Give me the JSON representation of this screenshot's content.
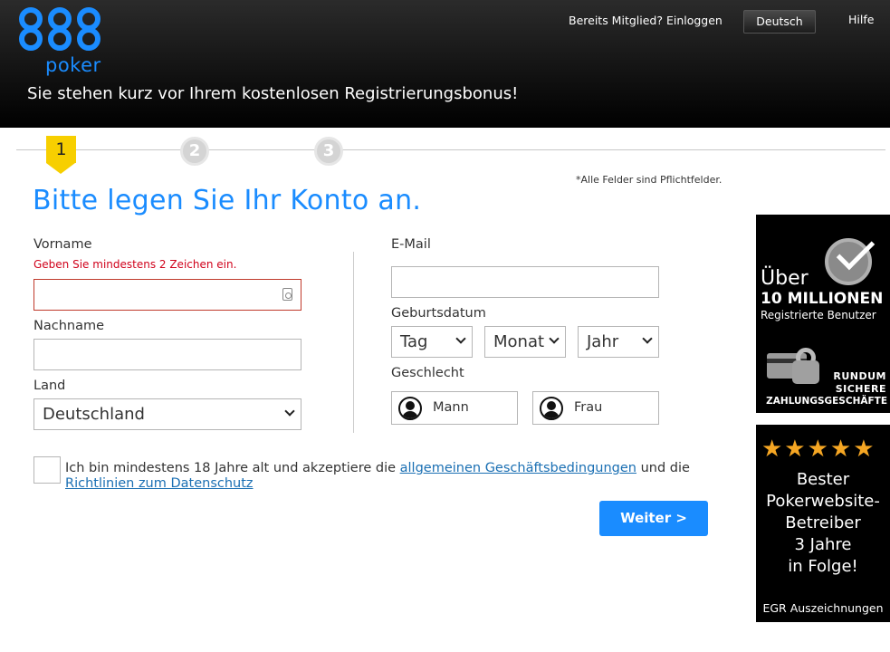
{
  "header": {
    "logo_number": "888",
    "logo_word": "poker",
    "tagline": "Sie stehen kurz vor Ihrem kostenlosen Registrierungsbonus!",
    "login_link": "Bereits Mitglied? Einloggen",
    "language": "Deutsch",
    "help": "Hilfe"
  },
  "stepper": {
    "steps": [
      "1",
      "2",
      "3"
    ],
    "active": 1
  },
  "required_note": "*Alle Felder sind Pflichtfelder.",
  "page_title": "Bitte legen Sie Ihr Konto an.",
  "form": {
    "first_name_label": "Vorname",
    "first_name_error": "Geben Sie mindestens 2 Zeichen ein.",
    "first_name_value": "",
    "last_name_label": "Nachname",
    "last_name_value": "",
    "country_label": "Land",
    "country_value": "Deutschland",
    "email_label": "E-Mail",
    "email_value": "",
    "birthdate_label": "Geburtsdatum",
    "day": "Tag",
    "month": "Monat",
    "year": "Jahr",
    "gender_label": "Geschlecht",
    "male": "Mann",
    "female": "Frau"
  },
  "terms": {
    "prefix": "Ich bin mindestens 18 Jahre alt und akzeptiere die ",
    "link1": "allgemeinen Geschäftsbedingungen",
    "middle": " und die",
    "link2": "Richtlinien zum Datenschutz",
    "checked": false
  },
  "submit_label": "Weiter >",
  "banner1": {
    "ueber": "Über",
    "count": "10 MILLIONEN",
    "registered": "Registrierte Benutzer",
    "secure1": "RUNDUM",
    "secure2": "SICHERE",
    "secure3": "ZAHLUNGSGESCHÄFTE",
    "badge_icon": "checkmark-badge-icon",
    "lock_icon": "card-lock-icon"
  },
  "banner2": {
    "stars": "★★★★★",
    "star_count": 5,
    "line1": "Bester",
    "line2": "Pokerwebsite-",
    "line3": "Betreiber",
    "line4": "3 Jahre",
    "line5": "in Folge!",
    "footer": "EGR Auszeichnungen"
  },
  "colors": {
    "brand_blue": "#1a8cff",
    "step_active": "#f7cf00",
    "error_red": "#d0021b",
    "link_blue": "#1a6fb3"
  }
}
